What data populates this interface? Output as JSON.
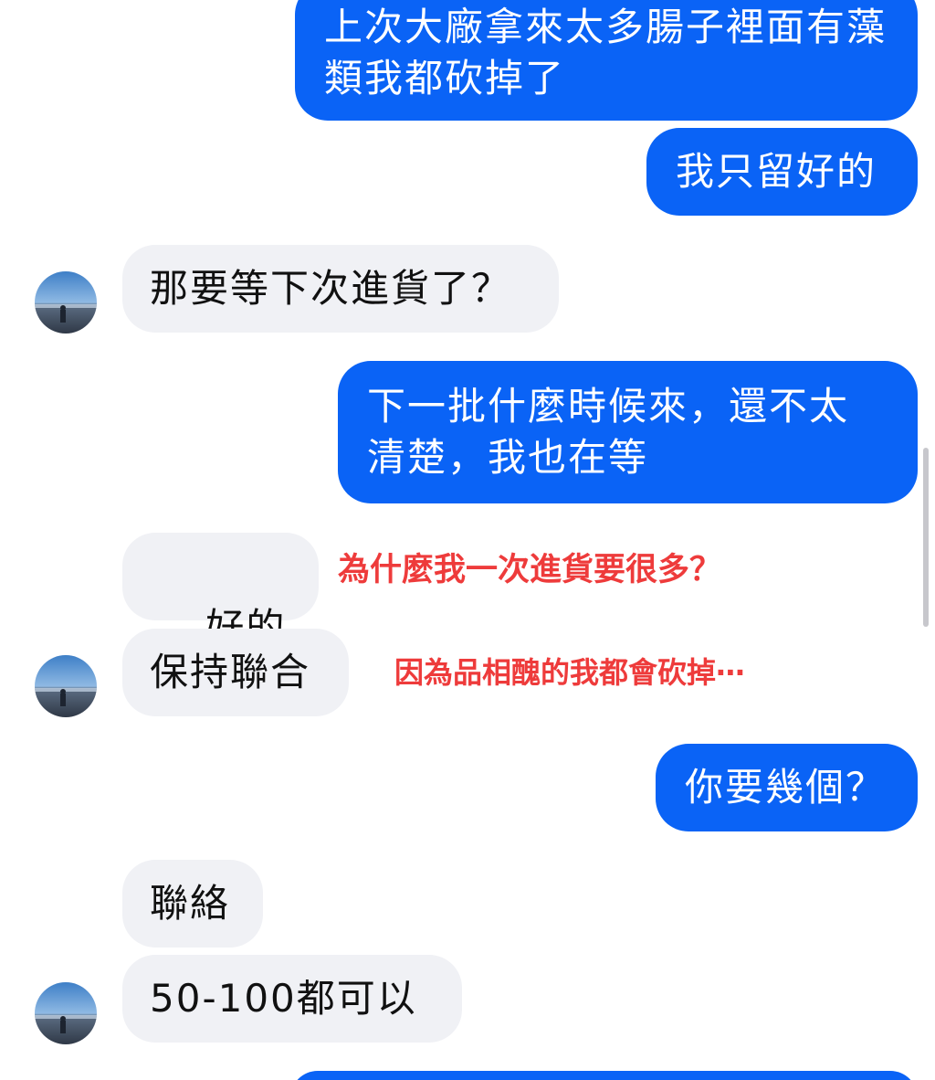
{
  "colors": {
    "outgoing_bubble": "#0a63f6",
    "incoming_bubble": "#f0f1f5",
    "annotation": "#ee3b3b"
  },
  "messages": [
    {
      "side": "outgoing",
      "text": "上次大廠拿來太多腸子裡面有藻類我都砍掉了"
    },
    {
      "side": "outgoing",
      "text": "我只留好的"
    },
    {
      "side": "incoming",
      "text": "那要等下次進貨了？"
    },
    {
      "side": "outgoing",
      "text": "下一批什麼時候來，還不太清楚，我也在等"
    },
    {
      "side": "incoming",
      "text": "好的",
      "emoji": "👌"
    },
    {
      "side": "incoming",
      "text": "保持聯合"
    },
    {
      "side": "outgoing",
      "text": "你要幾個？"
    },
    {
      "side": "incoming",
      "text": "聯絡"
    },
    {
      "side": "incoming",
      "text": "50-100都可以"
    }
  ],
  "annotations": [
    {
      "text": "為什麼我一次進貨要很多？"
    },
    {
      "text": "因為品相醜的我都會砍掉⋯"
    }
  ],
  "avatar": {
    "icon": "profile-photo-beach"
  }
}
